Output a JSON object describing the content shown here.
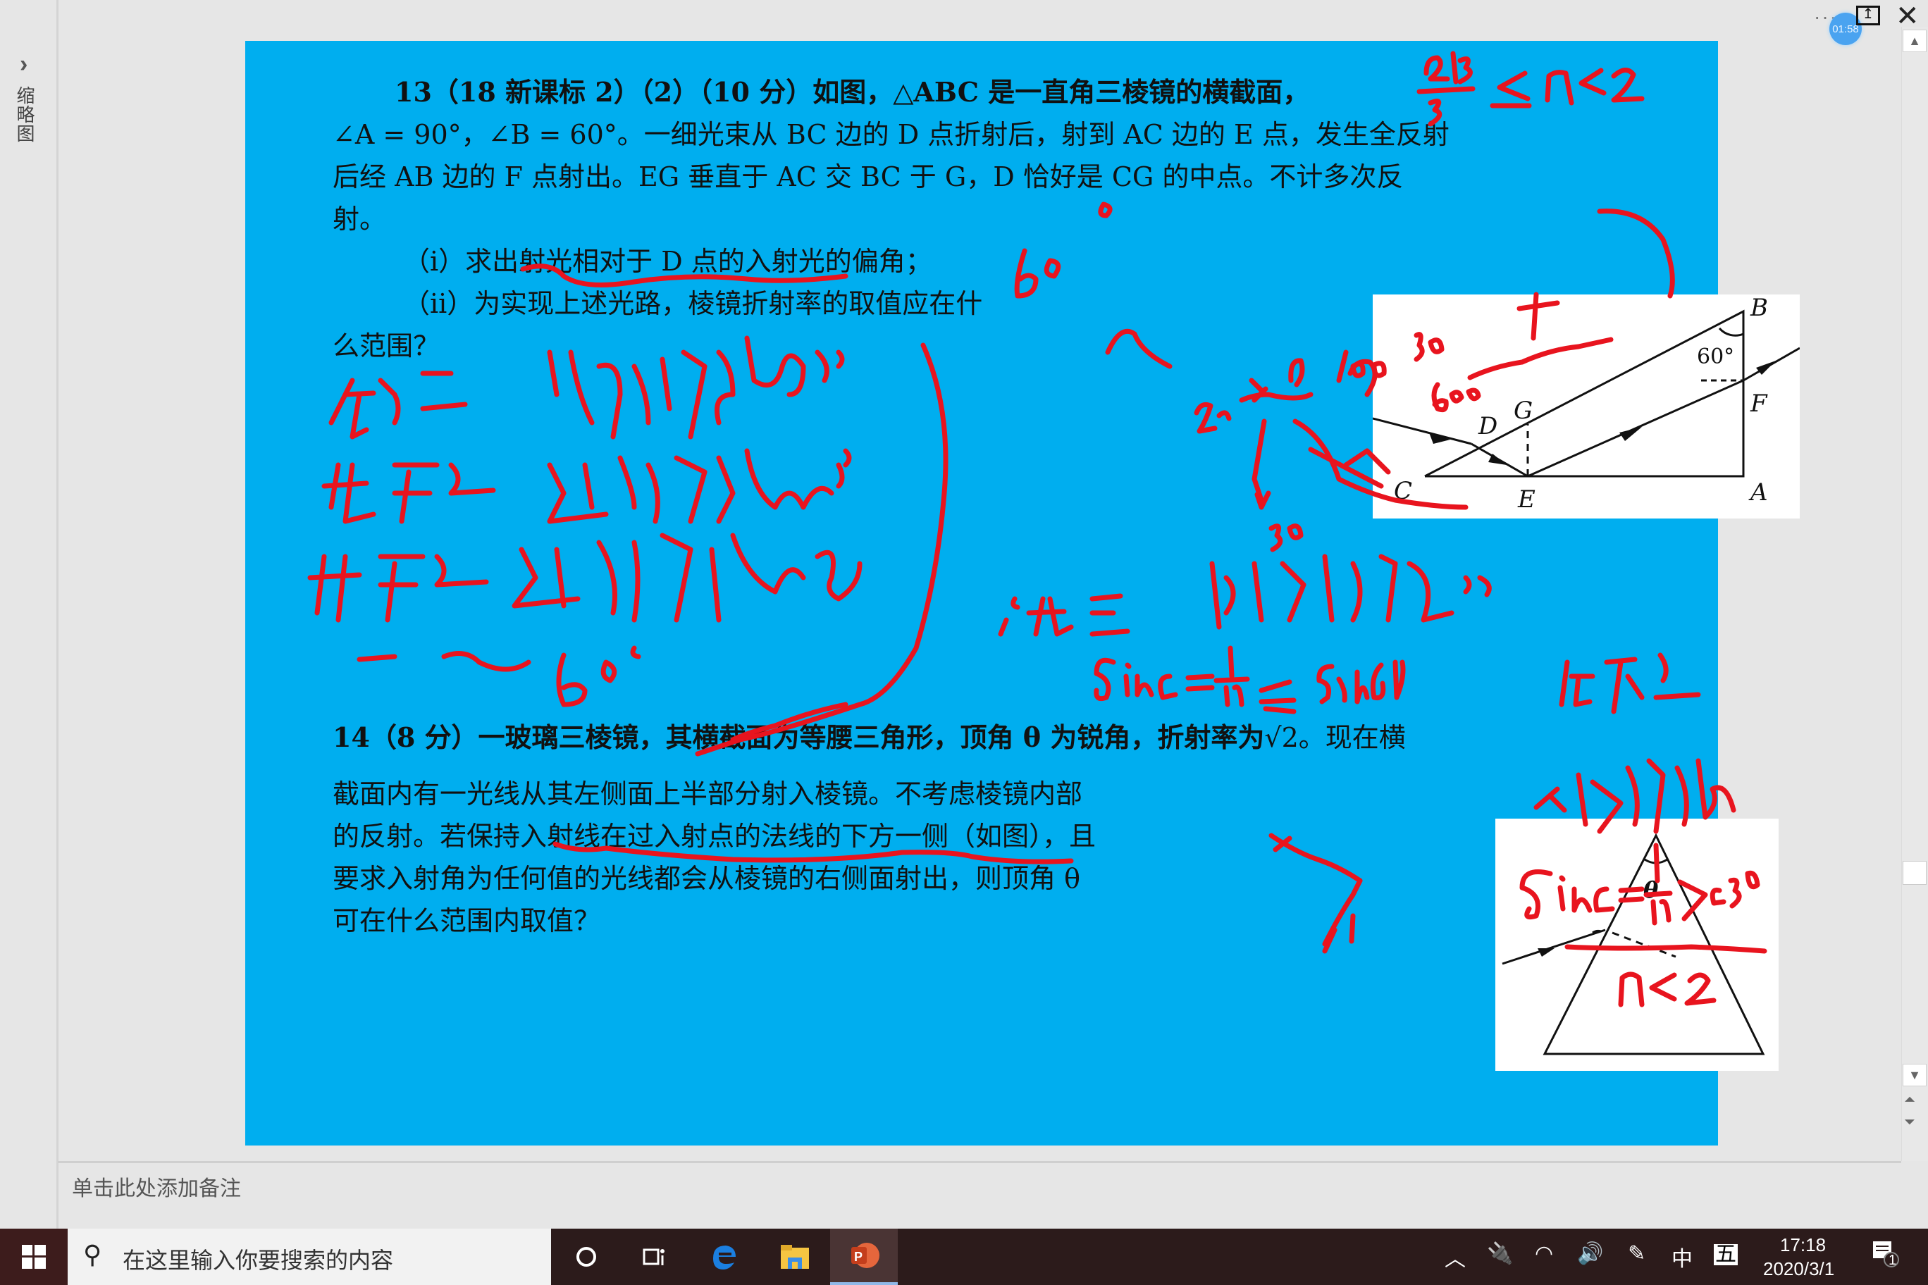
{
  "app": {
    "thumbnail_pane_label": "缩略图",
    "thumbnail_toggle_icon": "chevron-right-icon",
    "more_icon": "more-dots-icon",
    "timer": "01:58",
    "restore_icon": "restore-window-icon",
    "close_icon": "close-icon",
    "notes_placeholder": "单击此处添加备注"
  },
  "slide": {
    "background": "#00aeef",
    "q13": {
      "lines": [
        "13（18 新课标 2）（2）（10 分）如图，△ABC 是一直角三棱镜的横截面，",
        "∠A = 90°，∠B = 60°。一细光束从 BC 边的 D 点折射后，射到 AC 边的 E 点，发生全反射",
        "后经 AB 边的 F 点射出。EG 垂直于 AC 交 BC 于 G，D 恰好是 CG 的中点。不计多次反",
        "射。"
      ],
      "part_i": "（i）求出射光相对于 D 点的入射光的偏角；",
      "part_ii_line1": "（ii）为实现上述光路，棱镜折射率的取值应在什",
      "part_ii_line2": "么范围？",
      "figure_labels": {
        "B": "B",
        "G": "G",
        "D": "D",
        "F": "F",
        "C": "C",
        "E": "E",
        "A": "A",
        "angle": "60°"
      }
    },
    "q14": {
      "line1_prefix": "14（8 分）一玻璃三棱镜，其横截面为等腰三角形，顶角 θ 为锐角，折射率为",
      "line1_sqrt": "√2",
      "line1_suffix": "。现在横",
      "lines": [
        "截面内有一光线从其左侧面上半部分射入棱镜。不考虑棱镜内部",
        "的反射。若保持入射线在过入射点的法线的下方一侧（如图），且",
        "要求入射角为任何值的光线都会从棱镜的右侧面射出，则顶角 θ",
        "可在什么范围内取值？"
      ],
      "figure_label": "θ"
    },
    "annotation_color": "#e8141e",
    "handwritten_notes": [
      "2√3/3 < n < 2",
      "60°",
      "在D点 顺时针偏30°",
      "在E点 逆时针偏60°",
      "在F点 逆时针偏30°",
      "— — 60°",
      "1° 在E 能发生全反射",
      "sinC = 1/n ≤ sin60° 在F点",
      "不能全反射",
      "sinC = 1/n > sin30°",
      "n < 2"
    ]
  },
  "taskbar": {
    "start_icon": "windows-start-icon",
    "search_placeholder": "在这里输入你要搜索的内容",
    "apps": [
      {
        "name": "cortana",
        "icon": "cortana-circle-icon"
      },
      {
        "name": "task-view",
        "icon": "task-view-icon"
      },
      {
        "name": "edge",
        "icon": "edge-browser-icon"
      },
      {
        "name": "file-explorer",
        "icon": "folder-icon"
      },
      {
        "name": "powerpoint",
        "icon": "powerpoint-icon",
        "active": true
      }
    ],
    "tray": {
      "ime_lang": "中",
      "ime_mode": "五",
      "time": "17:18",
      "date": "2020/3/1",
      "notification_count": "1"
    }
  }
}
